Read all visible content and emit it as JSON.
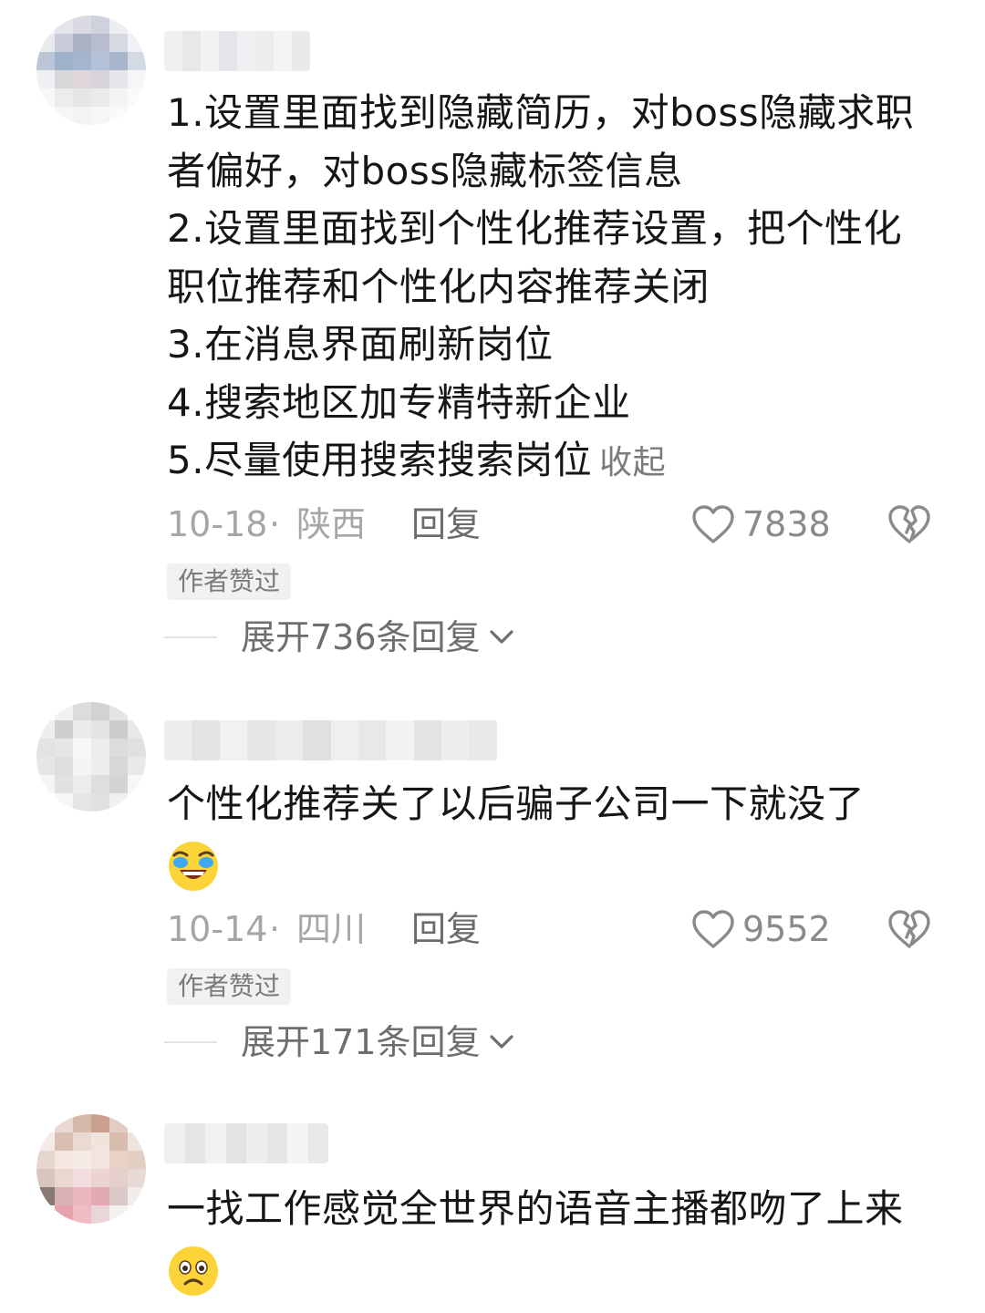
{
  "comments": [
    {
      "lines": [
        "1.设置里面找到隐藏简历，对boss隐藏求职",
        "者偏好，对boss隐藏标签信息",
        "2.设置里面找到个性化推荐设置，把个性化",
        "职位推荐和个性化内容推荐关闭",
        "3.在消息界面刷新岗位",
        "4.搜索地区加专精特新企业",
        "5.尽量使用搜索搜索岗位"
      ],
      "collapse_label": "收起",
      "date": "10-18",
      "separator": "·",
      "region": "陕西",
      "reply_label": "回复",
      "like_count": "7838",
      "badge": "作者赞过",
      "expand_label": "展开736条回复"
    },
    {
      "lines": [
        "个性化推荐关了以后骗子公司一下就没了"
      ],
      "emoji": "crying-laughing-emoji",
      "date": "10-14",
      "separator": "·",
      "region": "四川",
      "reply_label": "回复",
      "like_count": "9552",
      "badge": "作者赞过",
      "expand_label": "展开171条回复"
    },
    {
      "lines": [
        "一找工作感觉全世界的语音主播都吻了上来"
      ],
      "emoji": "frowning-emoji"
    }
  ],
  "icons": {
    "like": "heart-outline-icon",
    "dislike": "broken-heart-icon",
    "expand": "chevron-down-icon"
  },
  "colors": {
    "text": "#161616",
    "meta": "#a6a6a6",
    "badge_bg": "#f1f1f1"
  }
}
